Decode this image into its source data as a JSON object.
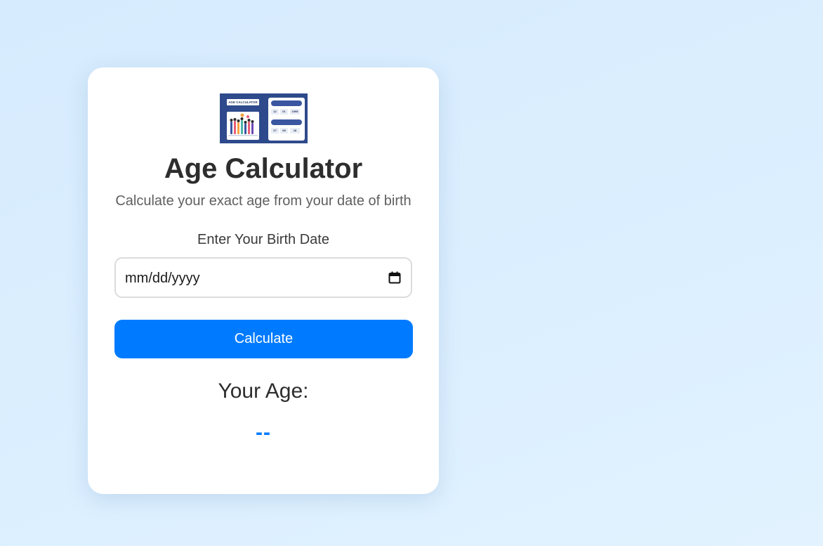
{
  "logo": {
    "title": "AGE CALCULATOR",
    "cells_row1": [
      "12",
      "01",
      "1995"
    ],
    "cells_row2": [
      "27",
      "08",
      "18"
    ]
  },
  "header": {
    "title": "Age Calculator",
    "subtitle": "Calculate your exact age from your date of birth"
  },
  "form": {
    "label": "Enter Your Birth Date",
    "date_placeholder": "mm/dd/yyyy",
    "calendar_icon": "calendar-icon",
    "button_label": "Calculate"
  },
  "result": {
    "heading": "Your Age:",
    "value": "--"
  },
  "colors": {
    "accent": "#007bff",
    "logo_background": "#2e4a8c",
    "page_background": "#d6ebfd"
  }
}
